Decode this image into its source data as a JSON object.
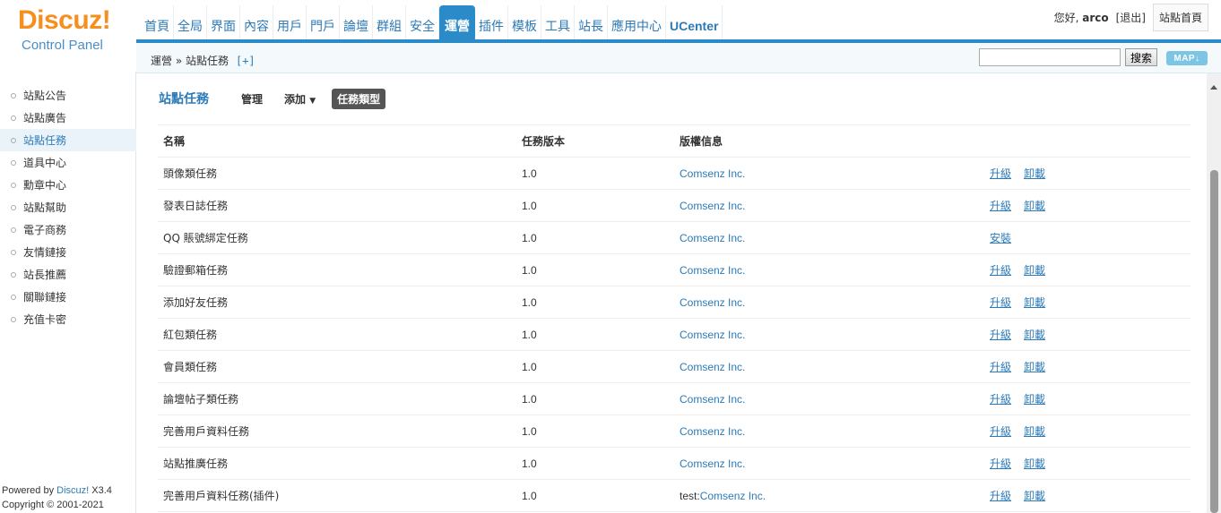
{
  "logo": {
    "brand": "Discuz",
    "bang": "!",
    "subtitle": "Control Panel"
  },
  "topnav": [
    "首頁",
    "全局",
    "界面",
    "內容",
    "用戶",
    "門戶",
    "論壇",
    "群組",
    "安全",
    "運營",
    "插件",
    "模板",
    "工具",
    "站長",
    "應用中心",
    "UCenter"
  ],
  "topnav_active": "運營",
  "user": {
    "greeting": "您好, ",
    "name": "arco",
    "logout": "[退出]",
    "home": "站點首頁"
  },
  "breadcrumb": {
    "text": "運營 » 站點任務",
    "plus": "[+]"
  },
  "search": {
    "placeholder": "",
    "button": "搜索",
    "map": "MAP"
  },
  "sidebar": {
    "items": [
      "站點公告",
      "站點廣告",
      "站點任務",
      "道具中心",
      "勳章中心",
      "站點幫助",
      "電子商務",
      "友情鏈接",
      "站長推薦",
      "關聯鏈接",
      "充值卡密"
    ],
    "active": "站點任務",
    "footer_powered": "Powered by ",
    "footer_brand": "Discuz!",
    "footer_version": " X3.4",
    "footer_copyright": "Copyright © 2001-2021"
  },
  "main": {
    "title": "站點任務",
    "tabs": {
      "manage": "管理",
      "add": "添加",
      "types": "任務類型"
    }
  },
  "table": {
    "headers": [
      "名稱",
      "任務版本",
      "版權信息",
      ""
    ],
    "rows": [
      {
        "name": "頭像類任務",
        "version": "1.0",
        "copy_prefix": "",
        "copy": "Comsenz Inc.",
        "actions": [
          "升級",
          "卸載"
        ]
      },
      {
        "name": "發表日誌任務",
        "version": "1.0",
        "copy_prefix": "",
        "copy": "Comsenz Inc.",
        "actions": [
          "升級",
          "卸載"
        ]
      },
      {
        "name": "QQ 賬號綁定任務",
        "version": "1.0",
        "copy_prefix": "",
        "copy": "Comsenz Inc.",
        "actions": [
          "安裝"
        ]
      },
      {
        "name": "驗證郵箱任務",
        "version": "1.0",
        "copy_prefix": "",
        "copy": "Comsenz Inc.",
        "actions": [
          "升級",
          "卸載"
        ]
      },
      {
        "name": "添加好友任務",
        "version": "1.0",
        "copy_prefix": "",
        "copy": "Comsenz Inc.",
        "actions": [
          "升級",
          "卸載"
        ]
      },
      {
        "name": "紅包類任務",
        "version": "1.0",
        "copy_prefix": "",
        "copy": "Comsenz Inc.",
        "actions": [
          "升級",
          "卸載"
        ]
      },
      {
        "name": "會員類任務",
        "version": "1.0",
        "copy_prefix": "",
        "copy": "Comsenz Inc.",
        "actions": [
          "升級",
          "卸載"
        ]
      },
      {
        "name": "論壇帖子類任務",
        "version": "1.0",
        "copy_prefix": "",
        "copy": "Comsenz Inc.",
        "actions": [
          "升級",
          "卸載"
        ]
      },
      {
        "name": "完善用戶資料任務",
        "version": "1.0",
        "copy_prefix": "",
        "copy": "Comsenz Inc.",
        "actions": [
          "升級",
          "卸載"
        ]
      },
      {
        "name": "站點推廣任務",
        "version": "1.0",
        "copy_prefix": "",
        "copy": "Comsenz Inc.",
        "actions": [
          "升級",
          "卸載"
        ]
      },
      {
        "name": "完善用戶資料任務(插件)",
        "version": "1.0",
        "copy_prefix": "test:",
        "copy": "Comsenz Inc.",
        "actions": [
          "升級",
          "卸載"
        ]
      }
    ]
  },
  "colors": {
    "accent": "#2b8bc8",
    "link": "#2c7ab6",
    "logo": "#f78f1e"
  }
}
